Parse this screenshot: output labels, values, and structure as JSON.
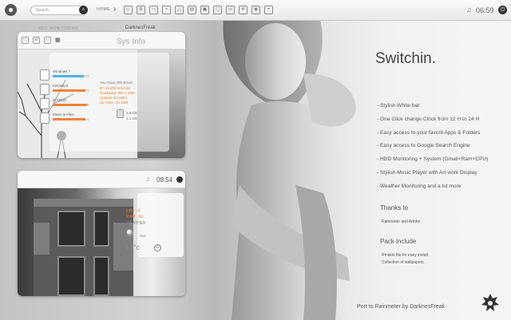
{
  "topbar": {
    "search_placeholder": "Search",
    "home_label": "HOME",
    "clock": "06:59",
    "icons": [
      "people-icon",
      "settings-icon",
      "monitor-icon",
      "wifi-icon",
      "triangle-icon",
      "folder-icon",
      "image-icon",
      "monitor-icon",
      "phone-icon",
      "gear-icon",
      "camera-icon",
      "pin-icon"
    ]
  },
  "hdd_widget": {
    "title": "HDD MONITORING",
    "drives": [
      {
        "label": "Windows 7",
        "fill": 0.85,
        "color": "#4cb2e0"
      },
      {
        "label": "CRONUS",
        "fill": 0.9,
        "color": "#f0843c"
      },
      {
        "label": "ICARUS",
        "fill": 0.93,
        "color": "#f0843c"
      },
      {
        "label": "Music & Files",
        "fill": 0.9,
        "color": "#f0843c"
      }
    ],
    "sys_info": {
      "title": "Sys Info",
      "email": "You Have 280 Email",
      "ip": "IP: 41.205.201.155",
      "download": "Download: 967.5 KB/s",
      "upload": "Upload: 5.2 KB/s",
      "uptime": "Up Time: 2H 40M",
      "ram_used": "3.5 GB",
      "ram_free": "1.1 GB"
    }
  },
  "music_widget": {
    "clock": "08:54",
    "name": "DarknesFreak",
    "cpu": "CPU : 5",
    "ram": "RAM : 43",
    "weather_label": "WEATHER",
    "sun": "Sun",
    "temp": "13°c"
  },
  "info": {
    "title": "Switchin.",
    "features": [
      "- Stylish White bar",
      "- One Click change Clock from 12 H to 24 H",
      "- Easy access to your favorit Apps & Folders",
      "- Easy access to Google Search Engine",
      "- HDD Monitoring + System (Gmail+Ram+CPU)",
      "- Stylish Music Player with Art work Display",
      "- Weather Monitoring and a lot more"
    ],
    "thanks_heading": "Thanks to",
    "thanks_text": "Rainmeter and Adobe",
    "pack_heading": "Pack include",
    "pack_items": [
      "Rmskin file for easy install",
      "Collection of wallpapers"
    ],
    "footer": "Port to Rainmeter by DarknesFreak"
  },
  "colors": {
    "accent_orange": "#f0843c",
    "accent_blue": "#4cb2e0",
    "cpu_orange": "#e8812f"
  }
}
